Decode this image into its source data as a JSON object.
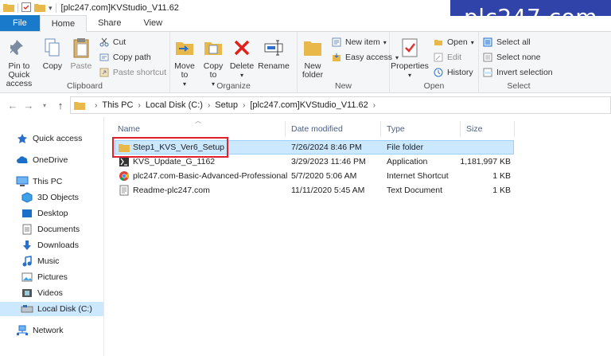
{
  "window": {
    "title": "[plc247.com]KVStudio_V11.62",
    "watermark": "plc247.com"
  },
  "tabs": [
    {
      "label": "File"
    },
    {
      "label": "Home"
    },
    {
      "label": "Share"
    },
    {
      "label": "View"
    }
  ],
  "ribbon": {
    "clipboard": {
      "label": "Clipboard",
      "pin": "Pin to Quick access",
      "copy": "Copy",
      "paste": "Paste",
      "cut": "Cut",
      "copy_path": "Copy path",
      "paste_shortcut": "Paste shortcut"
    },
    "organize": {
      "label": "Organize",
      "move_to": "Move to",
      "copy_to": "Copy to",
      "delete": "Delete",
      "rename": "Rename"
    },
    "new": {
      "label": "New",
      "new_folder": "New folder",
      "new_item": "New item",
      "easy_access": "Easy access"
    },
    "open": {
      "label": "Open",
      "properties": "Properties",
      "open": "Open",
      "edit": "Edit",
      "history": "History"
    },
    "select": {
      "label": "Select",
      "select_all": "Select all",
      "select_none": "Select none",
      "invert": "Invert selection"
    }
  },
  "breadcrumb": [
    "This PC",
    "Local Disk (C:)",
    "Setup",
    "[plc247.com]KVStudio_V11.62"
  ],
  "sidebar": {
    "items": [
      {
        "label": "Quick access"
      },
      {
        "label": "OneDrive"
      },
      {
        "label": "This PC"
      },
      {
        "label": "3D Objects"
      },
      {
        "label": "Desktop"
      },
      {
        "label": "Documents"
      },
      {
        "label": "Downloads"
      },
      {
        "label": "Music"
      },
      {
        "label": "Pictures"
      },
      {
        "label": "Videos"
      },
      {
        "label": "Local Disk (C:)"
      },
      {
        "label": "Network"
      }
    ]
  },
  "columns": {
    "name": "Name",
    "date": "Date modified",
    "type": "Type",
    "size": "Size"
  },
  "files": [
    {
      "name": "Step1_KVS_Ver6_Setup",
      "date": "7/26/2024 8:46 PM",
      "type": "File folder",
      "size": ""
    },
    {
      "name": "KVS_Update_G_1162",
      "date": "3/29/2023 11:46 PM",
      "type": "Application",
      "size": "1,181,997 KB"
    },
    {
      "name": "plc247.com-Basic-Advanced-Professional",
      "date": "5/7/2020 5:06 AM",
      "type": "Internet Shortcut",
      "size": "1 KB"
    },
    {
      "name": "Readme-plc247.com",
      "date": "11/11/2020 5:45 AM",
      "type": "Text Document",
      "size": "1 KB"
    }
  ],
  "colors": {
    "accent": "#1979ca",
    "selection": "#cce8ff",
    "highlight": "#e0202a",
    "watermark_bg": "#2f43a8"
  }
}
